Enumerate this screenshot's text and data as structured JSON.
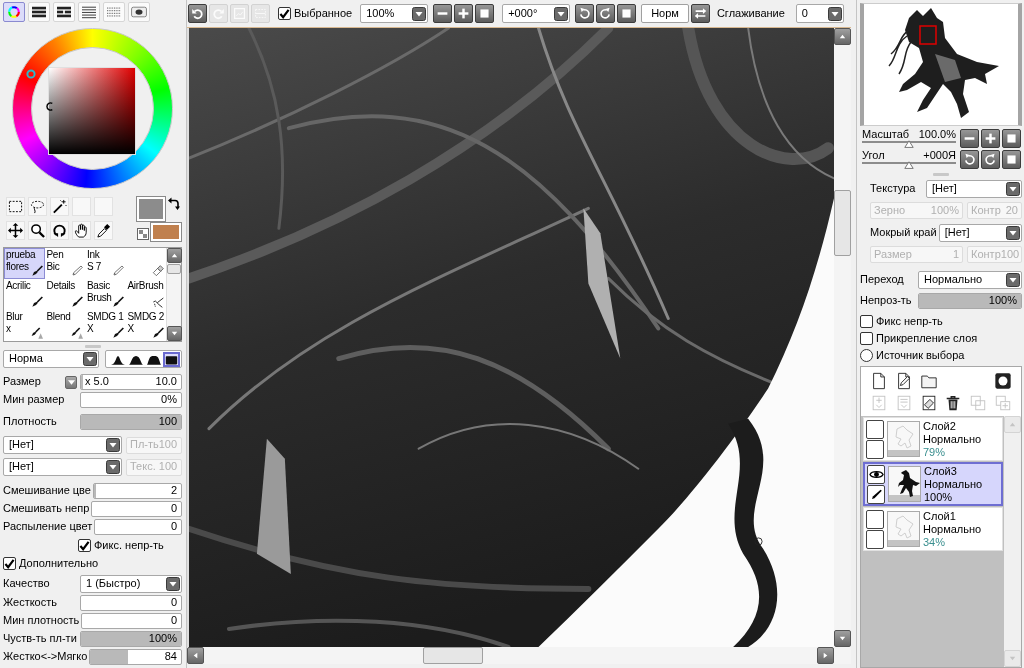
{
  "color_panel": {
    "tabs": [
      {
        "kind": "wheel",
        "selected": true
      },
      {
        "kind": "bars",
        "selected": false
      },
      {
        "kind": "split-bars",
        "selected": false
      },
      {
        "kind": "lines",
        "selected": false
      },
      {
        "kind": "grid",
        "selected": false
      },
      {
        "kind": "pad",
        "selected": false
      }
    ],
    "swatches": [
      {
        "color": "#8c8c8c"
      },
      {
        "color": "#c0804e"
      }
    ]
  },
  "tools": [
    {
      "kind": "rect-select"
    },
    {
      "kind": "lasso"
    },
    {
      "kind": "magic-wand"
    },
    {
      "kind": "empty"
    },
    {
      "kind": "empty"
    },
    {
      "kind": "move"
    },
    {
      "kind": "zoom"
    },
    {
      "kind": "rotate"
    },
    {
      "kind": "hand"
    },
    {
      "kind": "eyedropper"
    }
  ],
  "brushes": [
    {
      "lines": [
        "prueba",
        "flores"
      ],
      "kind": "brush",
      "selected": true
    },
    {
      "lines": [
        "Pen",
        "Bic"
      ],
      "kind": "pen",
      "selected": false
    },
    {
      "lines": [
        "Ink",
        "S 7"
      ],
      "kind": "pen",
      "selected": false
    },
    {
      "kind": "eraser",
      "selected": false
    },
    {
      "lines": [
        "Acrilic"
      ],
      "kind": "brush",
      "selected": false
    },
    {
      "lines": [
        "Details"
      ],
      "kind": "brush",
      "selected": false
    },
    {
      "lines": [
        "Basic",
        "Brush"
      ],
      "kind": "brush",
      "selected": false
    },
    {
      "lines": [
        "AirBrush"
      ],
      "kind": "airbrush",
      "selected": false
    },
    {
      "lines": [
        "Blur",
        "x"
      ],
      "kind": "blur-brush",
      "selected": false
    },
    {
      "lines": [
        "Blend"
      ],
      "kind": "blur-brush",
      "selected": false
    },
    {
      "lines": [
        "SMDG 1",
        "X"
      ],
      "kind": "brush",
      "selected": false
    },
    {
      "lines": [
        "SMDG 2",
        "X"
      ],
      "kind": "brush",
      "selected": false
    }
  ],
  "brush_settings": {
    "blend_mode": "Норма",
    "shapes": [
      {
        "kind": "peak",
        "selected": false
      },
      {
        "kind": "dome",
        "selected": false
      },
      {
        "kind": "flat",
        "selected": false
      },
      {
        "kind": "square",
        "selected": true
      }
    ],
    "size": {
      "label": "Размер",
      "multiplier": "x 5.0",
      "value": "10.0",
      "level": 0.02
    },
    "min_size": {
      "label": "Мин размер",
      "value": "0%",
      "level": 0
    },
    "density": {
      "label": "Плотность",
      "value": "100",
      "level": 1
    },
    "textures": [
      {
        "value": "[Нет]",
        "amount": "Пл-ть100",
        "disabled": true
      },
      {
        "value": "[Нет]",
        "amount": "Текс. 100",
        "disabled": true
      }
    ],
    "mixing": [
      {
        "label": "Смешивание цве",
        "value": "2",
        "level": 0.02
      },
      {
        "label": "Смешивать непр",
        "value": "0",
        "level": 0
      },
      {
        "label": "Распыление цвет",
        "value": "0",
        "level": 0
      }
    ],
    "lock_opacity": {
      "label": "Фикс. непр-ть",
      "checked": true
    },
    "advanced": {
      "label": "Дополнительно",
      "checked": true
    },
    "quality": {
      "label": "Качество",
      "value": "1 (Быстро)"
    },
    "advanced_sliders": [
      {
        "label": "Жесткость",
        "value": "0",
        "level": 0
      },
      {
        "label": "Мин плотность",
        "value": "0",
        "level": 0
      },
      {
        "label": "Чуств-ть пл-ти",
        "value": "100%",
        "level": 1
      },
      {
        "label": "Жестко<->Мягко",
        "value": "84",
        "level": 0.42
      }
    ]
  },
  "toolbar": [
    {
      "kind": "undo",
      "disabled": false
    },
    {
      "kind": "redo",
      "disabled": true
    },
    {
      "kind": "frame",
      "disabled": true
    },
    {
      "kind": "dashed-frame",
      "disabled": true
    },
    {
      "kind": "checkbox",
      "label": "Выбранное",
      "checked": true
    },
    {
      "kind": "dropdown",
      "value": "100%"
    },
    {
      "kind": "minus",
      "disabled": false
    },
    {
      "kind": "plus",
      "disabled": false
    },
    {
      "kind": "square",
      "disabled": false
    },
    {
      "kind": "dropdown",
      "value": "+000°"
    },
    {
      "kind": "rotate-left",
      "disabled": false
    },
    {
      "kind": "rotate-right",
      "disabled": false
    },
    {
      "kind": "square",
      "disabled": false
    },
    {
      "kind": "text-button",
      "label": "Норм"
    },
    {
      "kind": "flip",
      "disabled": false
    },
    {
      "kind": "label",
      "text": "Сглаживание"
    },
    {
      "kind": "dropdown",
      "value": "0"
    }
  ],
  "navigator": {
    "zoom": {
      "label": "Масштаб",
      "value": "100.0%",
      "level": 0.5
    },
    "angle": {
      "label": "Угол",
      "value": "+000Я",
      "level": 0.5
    },
    "zoom_buttons": [
      {
        "kind": "minus"
      },
      {
        "kind": "plus"
      },
      {
        "kind": "square"
      }
    ],
    "angle_buttons": [
      {
        "kind": "rotate-left"
      },
      {
        "kind": "rotate-right"
      },
      {
        "kind": "square"
      }
    ]
  },
  "paper": {
    "texture": {
      "label": "Текстура",
      "value": "[Нет]"
    },
    "texture_fields": [
      {
        "label": "Зерно",
        "value": "100%",
        "disabled": true
      },
      {
        "label": "Контр",
        "value": "20",
        "disabled": true
      }
    ],
    "wet_edge": {
      "label": "Мокрый край",
      "value": "[Нет]"
    },
    "wet_edge_fields": [
      {
        "label": "Размер",
        "value": "1",
        "disabled": true
      },
      {
        "label": "Контр",
        "value": "100",
        "disabled": true
      }
    ]
  },
  "layer_props": {
    "blend": {
      "label": "Переход",
      "value": "Нормально"
    },
    "opacity": {
      "label": "Непроз-ть",
      "value": "100%",
      "level": 1
    },
    "options": [
      {
        "kind": "checkbox",
        "label": "Фикс непр-ть",
        "checked": false
      },
      {
        "kind": "checkbox",
        "label": "Прикрепление слоя",
        "checked": false
      },
      {
        "kind": "radio",
        "label": "Источник выбора",
        "checked": false
      }
    ]
  },
  "layer_toolbar": [
    {
      "buttons": [
        {
          "kind": "page",
          "disabled": false
        },
        {
          "kind": "page-pen",
          "disabled": false
        },
        {
          "kind": "folder",
          "disabled": false
        },
        {
          "kind": "mask",
          "disabled": false
        }
      ]
    },
    {
      "buttons": [
        {
          "kind": "page-arrow",
          "disabled": true
        },
        {
          "kind": "page-merge",
          "disabled": true
        },
        {
          "kind": "eraser",
          "disabled": false
        },
        {
          "kind": "trash",
          "disabled": false
        },
        {
          "kind": "pages",
          "disabled": true
        },
        {
          "kind": "page-plus",
          "disabled": true
        }
      ]
    }
  ],
  "layers": [
    {
      "name": "Слой2",
      "mode": "Нормально",
      "opacity": "79%",
      "kind": "sketch",
      "visible": false,
      "editing": false,
      "selected": false
    },
    {
      "name": "Слой3",
      "mode": "Нормально",
      "opacity": "100%",
      "kind": "silhouette",
      "visible": true,
      "editing": true,
      "selected": true
    },
    {
      "name": "Слой1",
      "mode": "Нормально",
      "opacity": "34%",
      "kind": "sketch",
      "visible": false,
      "editing": false,
      "selected": false
    }
  ]
}
